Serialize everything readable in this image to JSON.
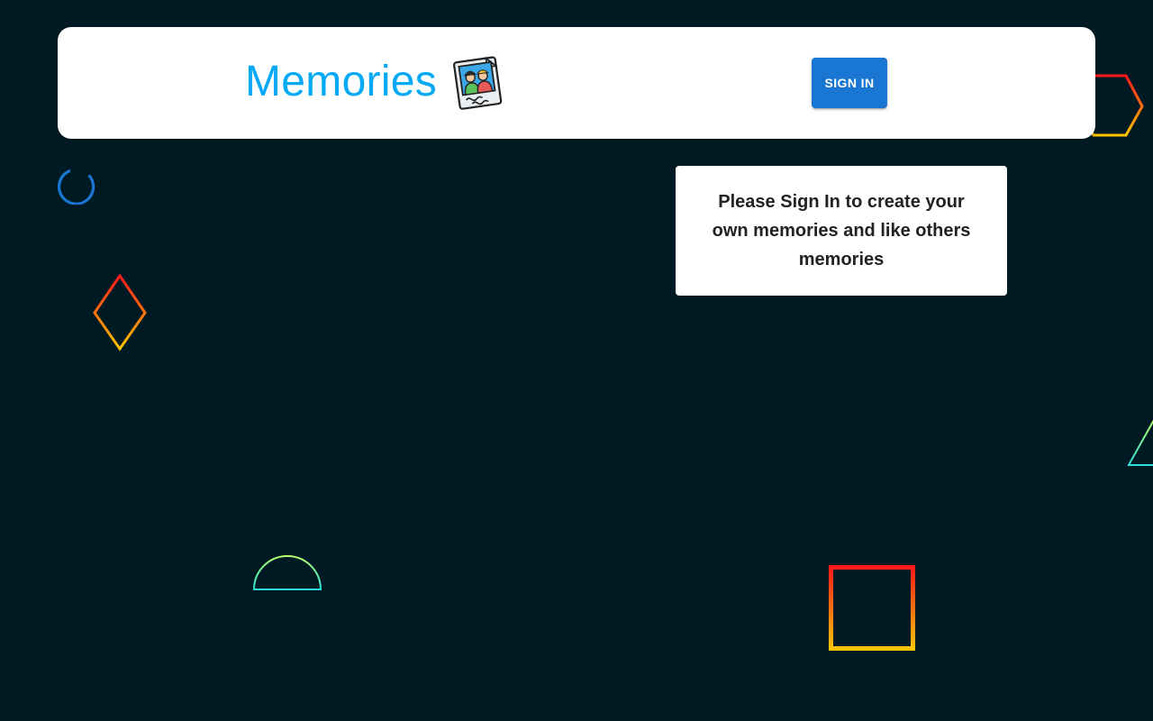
{
  "app": {
    "title": "Memories",
    "logo_icon": "photo-memories-icon",
    "brand_color": "#03a9f4",
    "background_color": "#001a24"
  },
  "header": {
    "sign_in_label": "SIGN IN",
    "sign_in_color": "#1976d2"
  },
  "main": {
    "loading_icon": "loading-spinner-icon",
    "notice_text": "Please Sign In to create your own memories and like others memories"
  },
  "background": {
    "shapes": [
      "hexagon",
      "diamond",
      "triangle",
      "semicircle",
      "square"
    ]
  }
}
